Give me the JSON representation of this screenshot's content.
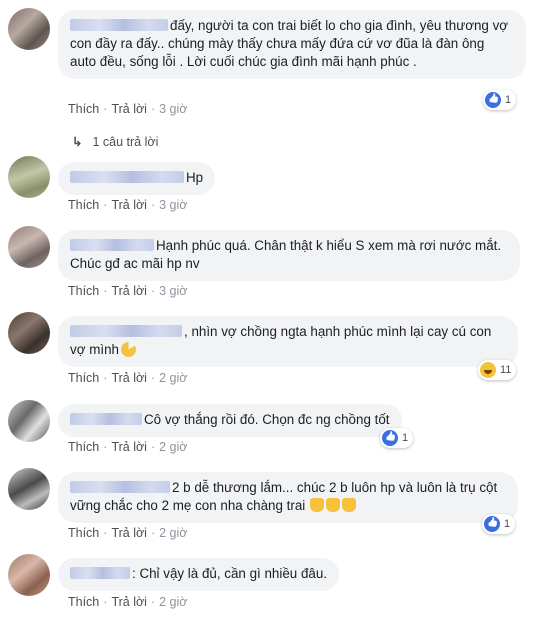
{
  "comments": [
    {
      "text": "đấy, người ta con trai biết lo cho gia đình, yêu thương vợ con đầy ra đấy.. chúng mày thấy chưa mấy đứa cứ vơ đũa là đàn ông auto đều, sống lỗi . Lời cuối chúc gia đình mãi hạnh phúc .",
      "like_label": "Thích",
      "reply_label": "Trả lời",
      "time": "3 giờ",
      "reaction": {
        "icon": "like-icon",
        "count": "1"
      },
      "replies_label": "1 câu trả lời"
    },
    {
      "text": "Hp",
      "like_label": "Thích",
      "reply_label": "Trả lời",
      "time": "3 giờ"
    },
    {
      "text": "Hạnh phúc quá. Chân thật k hiểu S xem mà rơi nước mắt. Chúc gđ ac mãi hp nv",
      "like_label": "Thích",
      "reply_label": "Trả lời",
      "time": "3 giờ"
    },
    {
      "text": ", nhìn vợ chồng ngta hạnh phúc mình lại cay cú con vợ mình",
      "like_label": "Thích",
      "reply_label": "Trả lời",
      "time": "2 giờ",
      "reaction": {
        "icon": "haha-icon",
        "count": "11"
      }
    },
    {
      "text": "Cô vợ thắng rồi đó. Chọn đc ng chồng tốt",
      "like_label": "Thích",
      "reply_label": "Trả lời",
      "time": "2 giờ",
      "reaction": {
        "icon": "like-icon",
        "count": "1"
      }
    },
    {
      "text": "2 b dễ thương lắm... chúc 2 b luôn hp và luôn là trụ cột vững chắc cho 2 mẹ con nha chàng trai",
      "like_label": "Thích",
      "reply_label": "Trả lời",
      "time": "2 giờ",
      "reaction": {
        "icon": "like-icon",
        "count": "1"
      }
    },
    {
      "text": ": Chỉ vậy là đủ, cần gì nhiều đâu.",
      "like_label": "Thích",
      "reply_label": "Trả lời",
      "time": "2 giờ"
    }
  ],
  "colors": {
    "bubble": "#f2f3f5",
    "like": "#3b6fe0",
    "haha": "#f5c33b"
  }
}
